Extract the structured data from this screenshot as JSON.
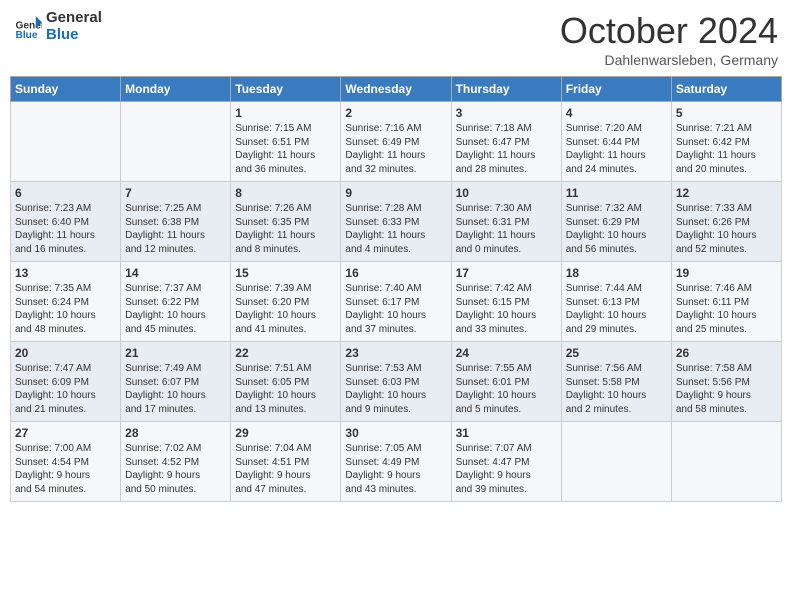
{
  "header": {
    "logo_line1": "General",
    "logo_line2": "Blue",
    "month": "October 2024",
    "location": "Dahlenwarsleben, Germany"
  },
  "days_of_week": [
    "Sunday",
    "Monday",
    "Tuesday",
    "Wednesday",
    "Thursday",
    "Friday",
    "Saturday"
  ],
  "weeks": [
    [
      {
        "day": "",
        "info": ""
      },
      {
        "day": "",
        "info": ""
      },
      {
        "day": "1",
        "info": "Sunrise: 7:15 AM\nSunset: 6:51 PM\nDaylight: 11 hours\nand 36 minutes."
      },
      {
        "day": "2",
        "info": "Sunrise: 7:16 AM\nSunset: 6:49 PM\nDaylight: 11 hours\nand 32 minutes."
      },
      {
        "day": "3",
        "info": "Sunrise: 7:18 AM\nSunset: 6:47 PM\nDaylight: 11 hours\nand 28 minutes."
      },
      {
        "day": "4",
        "info": "Sunrise: 7:20 AM\nSunset: 6:44 PM\nDaylight: 11 hours\nand 24 minutes."
      },
      {
        "day": "5",
        "info": "Sunrise: 7:21 AM\nSunset: 6:42 PM\nDaylight: 11 hours\nand 20 minutes."
      }
    ],
    [
      {
        "day": "6",
        "info": "Sunrise: 7:23 AM\nSunset: 6:40 PM\nDaylight: 11 hours\nand 16 minutes."
      },
      {
        "day": "7",
        "info": "Sunrise: 7:25 AM\nSunset: 6:38 PM\nDaylight: 11 hours\nand 12 minutes."
      },
      {
        "day": "8",
        "info": "Sunrise: 7:26 AM\nSunset: 6:35 PM\nDaylight: 11 hours\nand 8 minutes."
      },
      {
        "day": "9",
        "info": "Sunrise: 7:28 AM\nSunset: 6:33 PM\nDaylight: 11 hours\nand 4 minutes."
      },
      {
        "day": "10",
        "info": "Sunrise: 7:30 AM\nSunset: 6:31 PM\nDaylight: 11 hours\nand 0 minutes."
      },
      {
        "day": "11",
        "info": "Sunrise: 7:32 AM\nSunset: 6:29 PM\nDaylight: 10 hours\nand 56 minutes."
      },
      {
        "day": "12",
        "info": "Sunrise: 7:33 AM\nSunset: 6:26 PM\nDaylight: 10 hours\nand 52 minutes."
      }
    ],
    [
      {
        "day": "13",
        "info": "Sunrise: 7:35 AM\nSunset: 6:24 PM\nDaylight: 10 hours\nand 48 minutes."
      },
      {
        "day": "14",
        "info": "Sunrise: 7:37 AM\nSunset: 6:22 PM\nDaylight: 10 hours\nand 45 minutes."
      },
      {
        "day": "15",
        "info": "Sunrise: 7:39 AM\nSunset: 6:20 PM\nDaylight: 10 hours\nand 41 minutes."
      },
      {
        "day": "16",
        "info": "Sunrise: 7:40 AM\nSunset: 6:17 PM\nDaylight: 10 hours\nand 37 minutes."
      },
      {
        "day": "17",
        "info": "Sunrise: 7:42 AM\nSunset: 6:15 PM\nDaylight: 10 hours\nand 33 minutes."
      },
      {
        "day": "18",
        "info": "Sunrise: 7:44 AM\nSunset: 6:13 PM\nDaylight: 10 hours\nand 29 minutes."
      },
      {
        "day": "19",
        "info": "Sunrise: 7:46 AM\nSunset: 6:11 PM\nDaylight: 10 hours\nand 25 minutes."
      }
    ],
    [
      {
        "day": "20",
        "info": "Sunrise: 7:47 AM\nSunset: 6:09 PM\nDaylight: 10 hours\nand 21 minutes."
      },
      {
        "day": "21",
        "info": "Sunrise: 7:49 AM\nSunset: 6:07 PM\nDaylight: 10 hours\nand 17 minutes."
      },
      {
        "day": "22",
        "info": "Sunrise: 7:51 AM\nSunset: 6:05 PM\nDaylight: 10 hours\nand 13 minutes."
      },
      {
        "day": "23",
        "info": "Sunrise: 7:53 AM\nSunset: 6:03 PM\nDaylight: 10 hours\nand 9 minutes."
      },
      {
        "day": "24",
        "info": "Sunrise: 7:55 AM\nSunset: 6:01 PM\nDaylight: 10 hours\nand 5 minutes."
      },
      {
        "day": "25",
        "info": "Sunrise: 7:56 AM\nSunset: 5:58 PM\nDaylight: 10 hours\nand 2 minutes."
      },
      {
        "day": "26",
        "info": "Sunrise: 7:58 AM\nSunset: 5:56 PM\nDaylight: 9 hours\nand 58 minutes."
      }
    ],
    [
      {
        "day": "27",
        "info": "Sunrise: 7:00 AM\nSunset: 4:54 PM\nDaylight: 9 hours\nand 54 minutes."
      },
      {
        "day": "28",
        "info": "Sunrise: 7:02 AM\nSunset: 4:52 PM\nDaylight: 9 hours\nand 50 minutes."
      },
      {
        "day": "29",
        "info": "Sunrise: 7:04 AM\nSunset: 4:51 PM\nDaylight: 9 hours\nand 47 minutes."
      },
      {
        "day": "30",
        "info": "Sunrise: 7:05 AM\nSunset: 4:49 PM\nDaylight: 9 hours\nand 43 minutes."
      },
      {
        "day": "31",
        "info": "Sunrise: 7:07 AM\nSunset: 4:47 PM\nDaylight: 9 hours\nand 39 minutes."
      },
      {
        "day": "",
        "info": ""
      },
      {
        "day": "",
        "info": ""
      }
    ]
  ]
}
